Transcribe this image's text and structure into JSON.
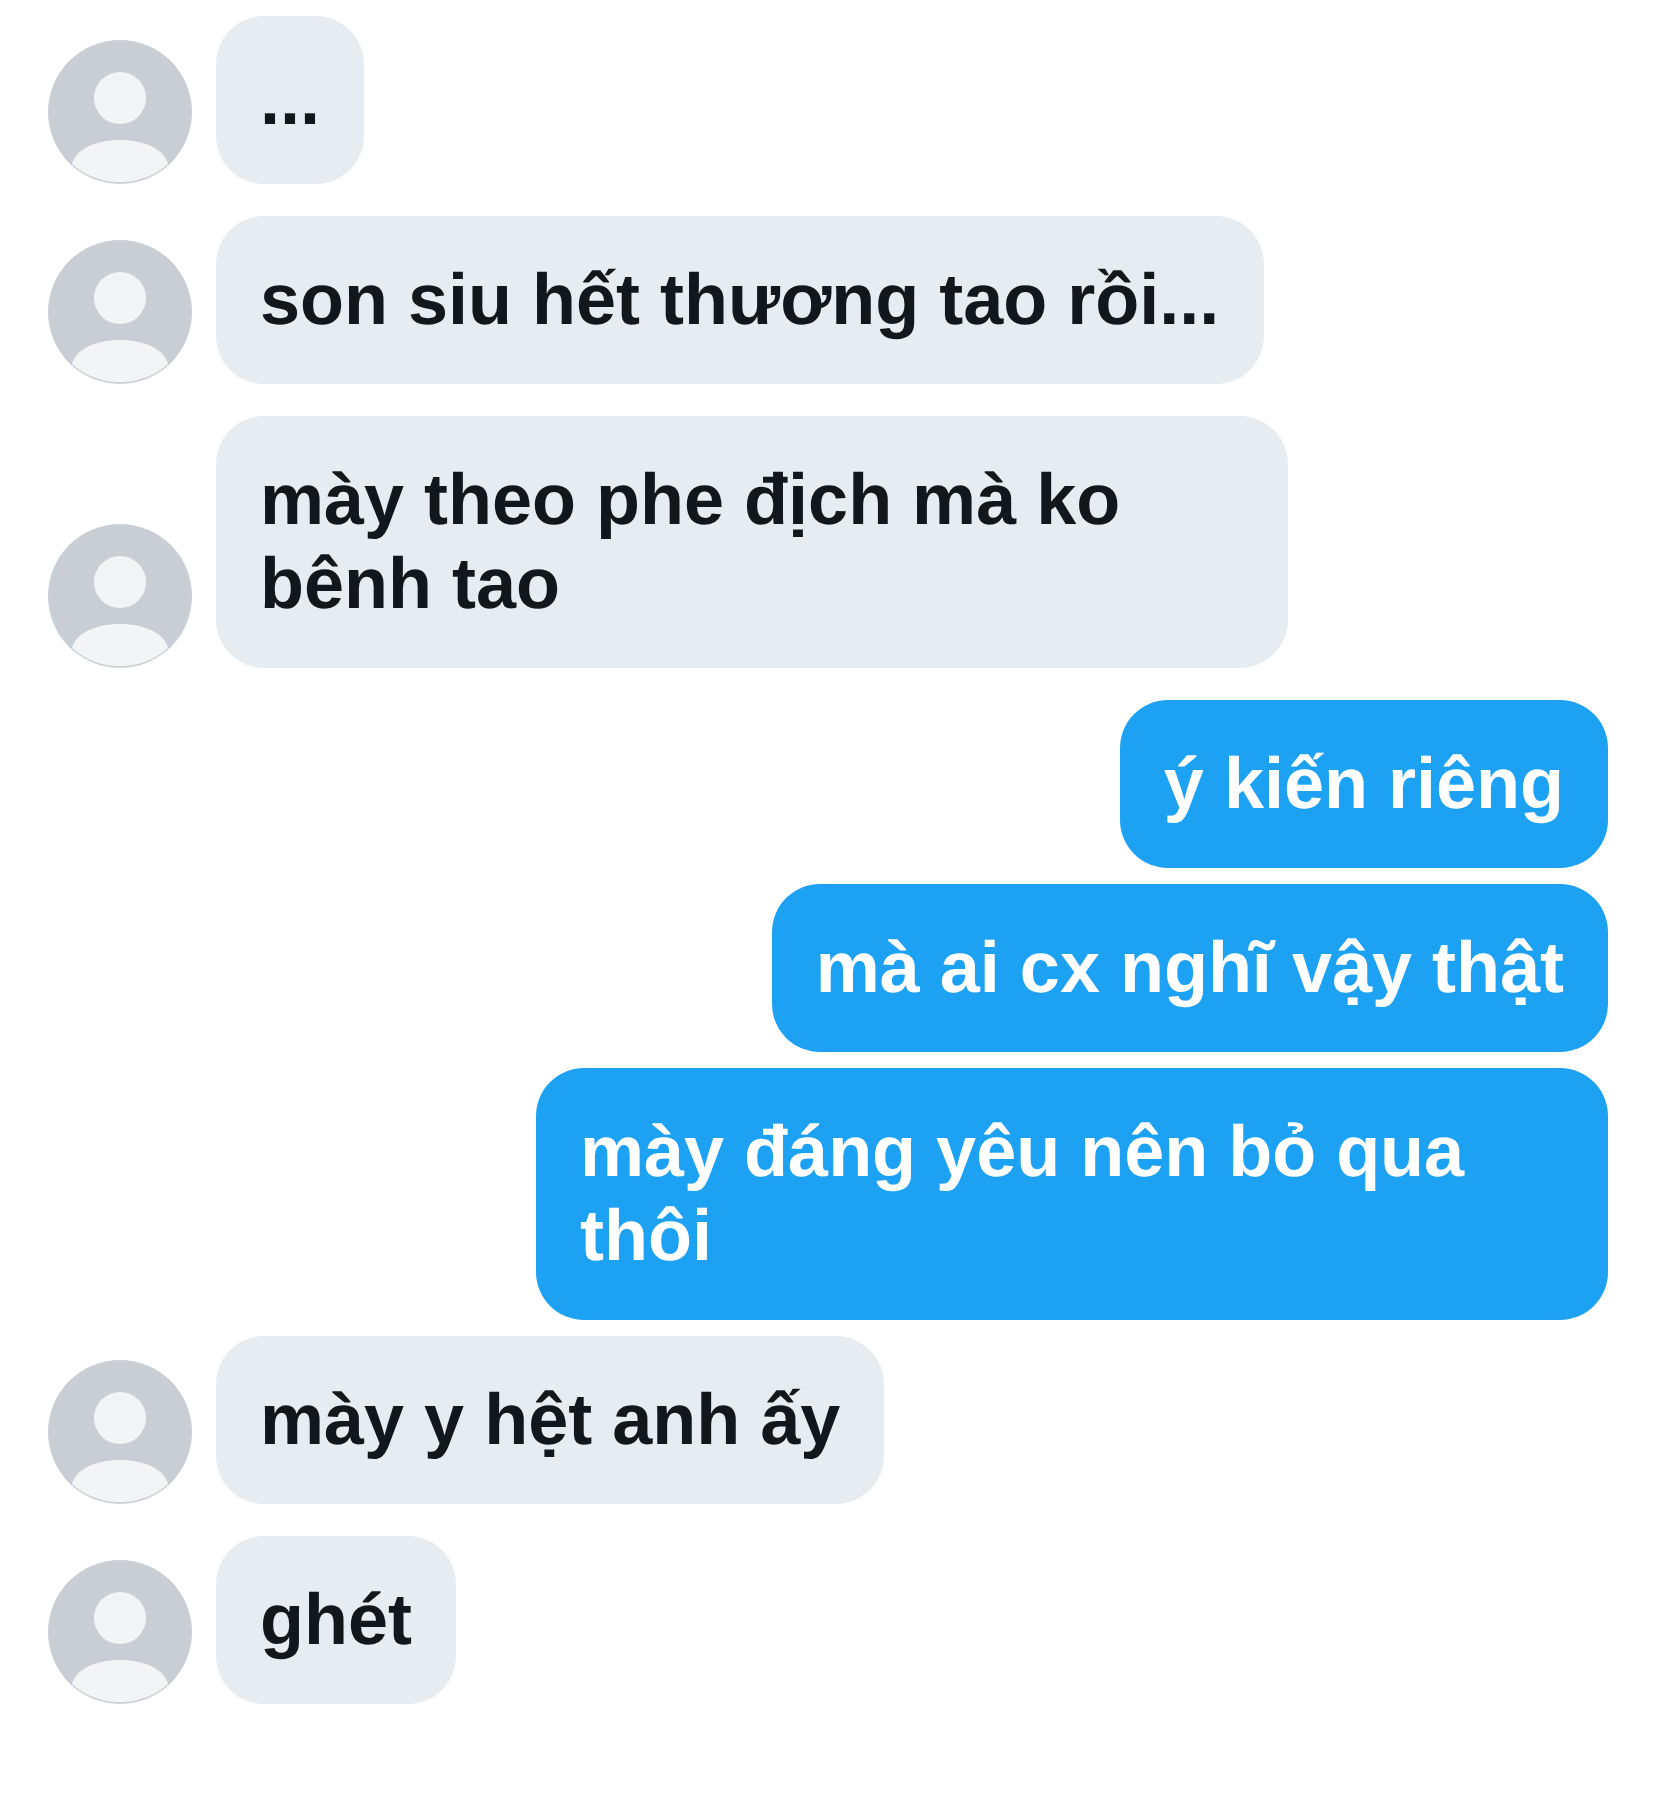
{
  "messages": [
    {
      "kind": "incoming",
      "text": "..."
    },
    {
      "kind": "incoming",
      "text": "son siu hết thương tao rồi..."
    },
    {
      "kind": "incoming",
      "text": "mày theo phe địch mà ko bênh tao"
    },
    {
      "kind": "outgoing",
      "text": "ý kiến riêng"
    },
    {
      "kind": "outgoing",
      "text": "mà ai cx nghĩ vậy thật"
    },
    {
      "kind": "outgoing",
      "text": "mày đáng yêu nên bỏ qua thôi"
    },
    {
      "kind": "incoming",
      "text": "mày y hệt anh ấy"
    },
    {
      "kind": "incoming",
      "text": "ghét"
    }
  ]
}
